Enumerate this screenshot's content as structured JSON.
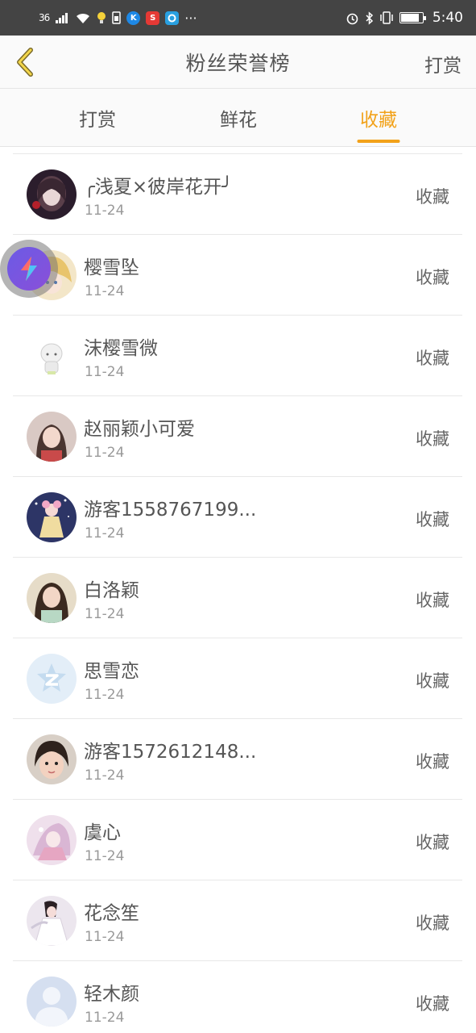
{
  "status_bar": {
    "signal": "36",
    "time": "5:40",
    "dots": "···",
    "apps": [
      {
        "letter": "K",
        "color": "#1e88e5"
      },
      {
        "letter": "S",
        "color": "#e53935"
      },
      {
        "letter": "",
        "color": "#29a0e0"
      }
    ]
  },
  "header": {
    "title": "粉丝荣誉榜",
    "action": "打赏",
    "accent": "#f2a21a"
  },
  "tabs": [
    {
      "label": "打赏",
      "active": false
    },
    {
      "label": "鲜花",
      "active": false
    },
    {
      "label": "收藏",
      "active": true
    }
  ],
  "rows": [
    {
      "name": "╭浅夏×彼岸花开╯",
      "date": "11-24",
      "action": "收藏",
      "avatar": "dark-girl"
    },
    {
      "name": "樱雪坠",
      "date": "11-24",
      "action": "收藏",
      "avatar": "anime-blonde"
    },
    {
      "name": "沫樱雪微",
      "date": "11-24",
      "action": "收藏",
      "avatar": "chibi"
    },
    {
      "name": "赵丽颖小可爱",
      "date": "11-24",
      "action": "收藏",
      "avatar": "photo-girl"
    },
    {
      "name": "游客1558767199...",
      "date": "11-24",
      "action": "收藏",
      "avatar": "night-anime"
    },
    {
      "name": "白洛颖",
      "date": "11-24",
      "action": "收藏",
      "avatar": "photo-girl-2"
    },
    {
      "name": "思雪恋",
      "date": "11-24",
      "action": "收藏",
      "avatar": "qzone-default"
    },
    {
      "name": "游客1572612148...",
      "date": "11-24",
      "action": "收藏",
      "avatar": "child-photo"
    },
    {
      "name": "虞心",
      "date": "11-24",
      "action": "收藏",
      "avatar": "pink-anime"
    },
    {
      "name": "花念笙",
      "date": "11-24",
      "action": "收藏",
      "avatar": "white-dress"
    },
    {
      "name": "轻木颜",
      "date": "11-24",
      "action": "收藏",
      "avatar": "default-user"
    }
  ]
}
